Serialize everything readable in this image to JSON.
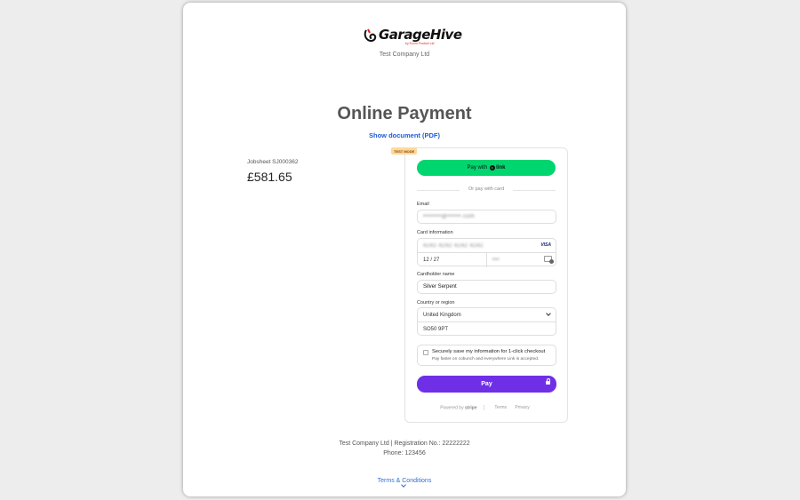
{
  "brand": {
    "name": "GarageHive",
    "tagline": "by Ecom Product Ltd"
  },
  "company": "Test Company Ltd",
  "page_title": "Online Payment",
  "show_document": "Show document (PDF)",
  "invoice": {
    "jobsheet": "Jobsheet SJ000362",
    "amount": "£581.65"
  },
  "payment": {
    "test_mode": "TEST MODE",
    "link_button": {
      "prefix": "Pay with",
      "brand": "link"
    },
    "or_text": "Or pay with card",
    "email_label": "Email",
    "email_value": "••••••••@••••••.com",
    "card_label": "Card information",
    "card_number": "4242 4242 4242 4242",
    "card_brand": "VISA",
    "card_expiry": "12 / 27",
    "card_cvc": "•••",
    "cardholder_label": "Cardholder name",
    "cardholder_value": "Silver Serpent",
    "country_label": "Country or region",
    "country_value": "United Kingdom",
    "postcode_value": "SO50 9PT",
    "save_title": "Securely save my information for 1-click checkout",
    "save_sub": "Pay faster on cobunch and everywhere Link is accepted.",
    "pay_button": "Pay",
    "powered_by": "Powered by",
    "stripe": "stripe",
    "terms_link": "Terms",
    "privacy_link": "Privacy"
  },
  "footer": {
    "registration": "Test Company Ltd | Registration No.: 22222222",
    "phone": "Phone: 123456",
    "terms": "Terms & Conditions"
  },
  "colors": {
    "link_green": "#00d66f",
    "pay_purple": "#6f2fe6",
    "link_blue": "#1f5bd8",
    "brand_red": "#e02020"
  }
}
